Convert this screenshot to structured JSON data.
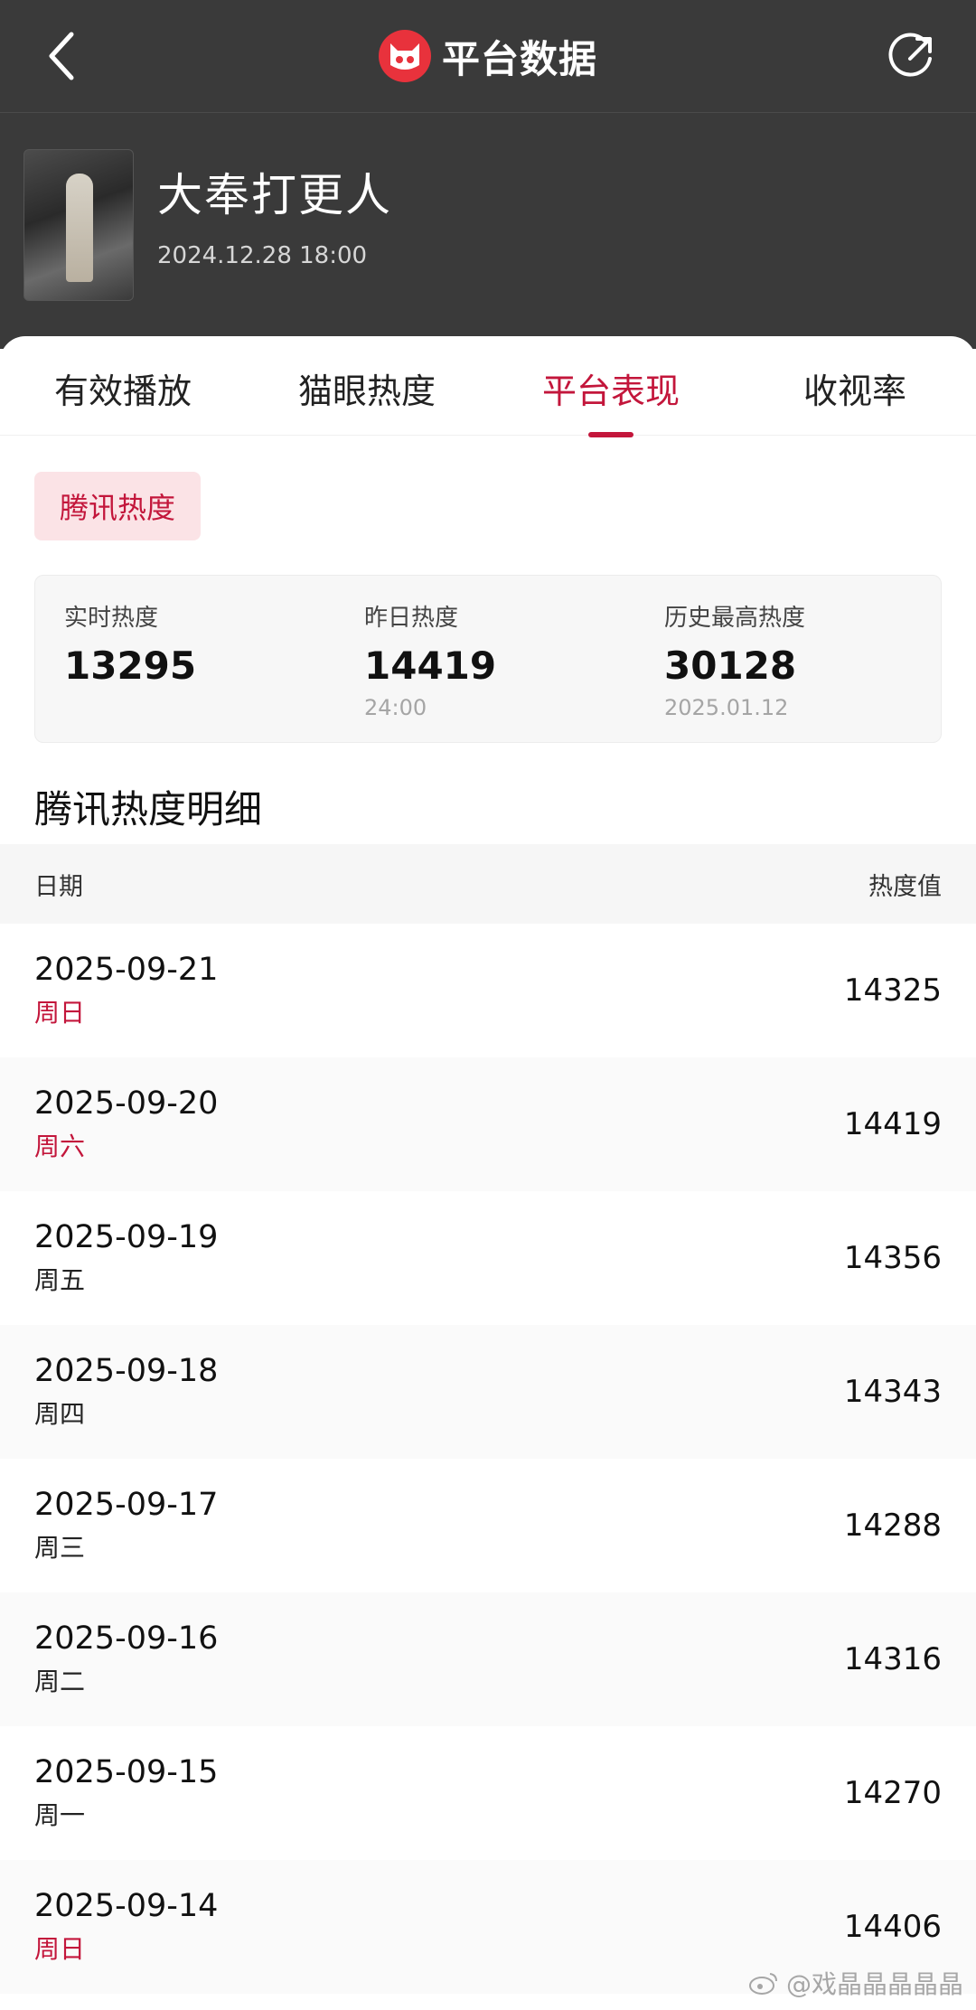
{
  "header": {
    "title": "平台数据",
    "back_icon": "chevron-left-icon",
    "share_icon": "share-icon",
    "logo_icon": "cat-logo-icon"
  },
  "show": {
    "title": "大奉打更人",
    "datetime": "2024.12.28 18:00"
  },
  "tabs": [
    {
      "label": "有效播放",
      "active": false
    },
    {
      "label": "猫眼热度",
      "active": false
    },
    {
      "label": "平台表现",
      "active": true
    },
    {
      "label": "收视率",
      "active": false
    }
  ],
  "chip": {
    "label": "腾讯热度"
  },
  "stats": [
    {
      "label": "实时热度",
      "value": "13295",
      "sub": ""
    },
    {
      "label": "昨日热度",
      "value": "14419",
      "sub": "24:00"
    },
    {
      "label": "历史最高热度",
      "value": "30128",
      "sub": "2025.01.12"
    }
  ],
  "detail": {
    "title": "腾讯热度明细",
    "col_date": "日期",
    "col_value": "热度值",
    "rows": [
      {
        "date": "2025-09-21",
        "weekday": "周日",
        "weekend": true,
        "value": "14325"
      },
      {
        "date": "2025-09-20",
        "weekday": "周六",
        "weekend": true,
        "value": "14419"
      },
      {
        "date": "2025-09-19",
        "weekday": "周五",
        "weekend": false,
        "value": "14356"
      },
      {
        "date": "2025-09-18",
        "weekday": "周四",
        "weekend": false,
        "value": "14343"
      },
      {
        "date": "2025-09-17",
        "weekday": "周三",
        "weekend": false,
        "value": "14288"
      },
      {
        "date": "2025-09-16",
        "weekday": "周二",
        "weekend": false,
        "value": "14316"
      },
      {
        "date": "2025-09-15",
        "weekday": "周一",
        "weekend": false,
        "value": "14270"
      },
      {
        "date": "2025-09-14",
        "weekday": "周日",
        "weekend": true,
        "value": "14406"
      }
    ]
  },
  "watermark": "@戏晶晶晶晶晶",
  "colors": {
    "accent": "#c3163b",
    "header_bg": "#3a3a3a",
    "chip_bg": "#fbe3e6"
  }
}
